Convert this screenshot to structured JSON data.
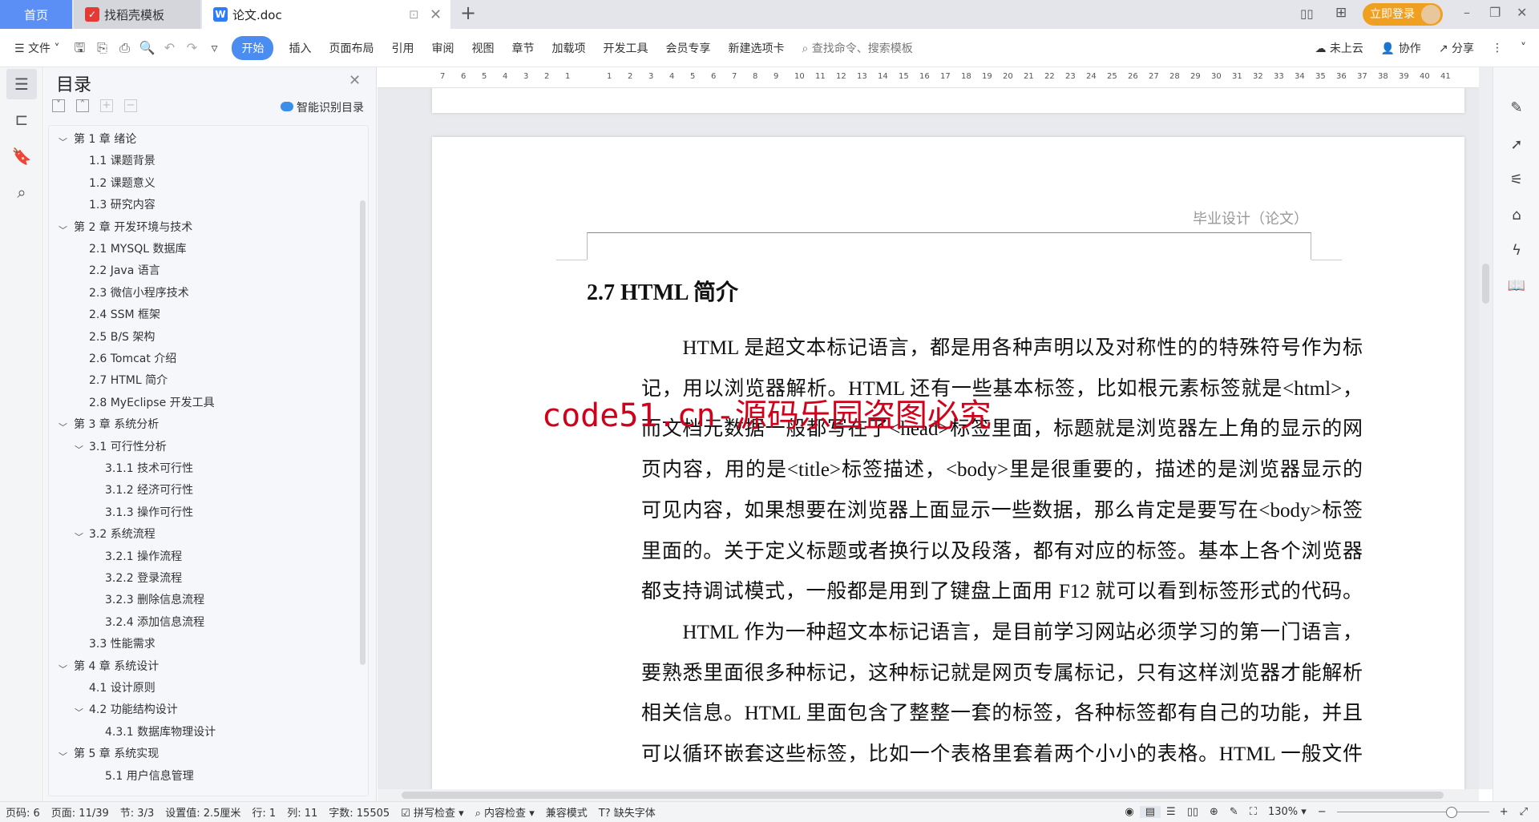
{
  "tabs": {
    "home": "首页",
    "template": "找稻壳模板",
    "doc": "论文.doc",
    "new_tab": "+"
  },
  "titlebar": {
    "login": "立即登录"
  },
  "toolbar": {
    "file": "文件",
    "menus": [
      "开始",
      "插入",
      "页面布局",
      "引用",
      "审阅",
      "视图",
      "章节",
      "加载项",
      "开发工具",
      "会员专享",
      "新建选项卡"
    ],
    "search_placeholder": "查找命令、搜索模板",
    "cloud": "未上云",
    "collab": "协作",
    "share": "分享"
  },
  "toc": {
    "title": "目录",
    "smart": "智能识别目录",
    "items": [
      {
        "label": "第 1 章  绪论",
        "level": 1,
        "expanded": true
      },
      {
        "label": "1.1  课题背景",
        "level": 2
      },
      {
        "label": "1.2  课题意义",
        "level": 2
      },
      {
        "label": "1.3  研究内容",
        "level": 2
      },
      {
        "label": "第 2 章  开发环境与技术",
        "level": 1,
        "expanded": true
      },
      {
        "label": "2.1 MYSQL 数据库",
        "level": 2
      },
      {
        "label": "2.2 Java 语言",
        "level": 2
      },
      {
        "label": "2.3  微信小程序技术",
        "level": 2
      },
      {
        "label": "2.4 SSM 框架",
        "level": 2
      },
      {
        "label": "2.5 B/S 架构",
        "level": 2
      },
      {
        "label": "2.6 Tomcat  介绍",
        "level": 2
      },
      {
        "label": "2.7 HTML 简介",
        "level": 2
      },
      {
        "label": "2.8 MyEclipse 开发工具",
        "level": 2
      },
      {
        "label": "第 3 章  系统分析",
        "level": 1,
        "expanded": true
      },
      {
        "label": "3.1  可行性分析",
        "level": 2,
        "expanded": true
      },
      {
        "label": "3.1.1  技术可行性",
        "level": 3
      },
      {
        "label": "3.1.2  经济可行性",
        "level": 3
      },
      {
        "label": "3.1.3  操作可行性",
        "level": 3
      },
      {
        "label": "3.2  系统流程",
        "level": 2,
        "expanded": true
      },
      {
        "label": "3.2.1  操作流程",
        "level": 3
      },
      {
        "label": "3.2.2  登录流程",
        "level": 3
      },
      {
        "label": "3.2.3  删除信息流程",
        "level": 3
      },
      {
        "label": "3.2.4  添加信息流程",
        "level": 3
      },
      {
        "label": "3.3  性能需求",
        "level": 2
      },
      {
        "label": "第 4 章  系统设计",
        "level": 1,
        "expanded": true
      },
      {
        "label": "4.1  设计原则",
        "level": 2
      },
      {
        "label": "4.2  功能结构设计",
        "level": 2,
        "expanded": true
      },
      {
        "label": "4.3.1  数据库物理设计",
        "level": 3
      },
      {
        "label": "第 5 章  系统实现",
        "level": 1,
        "expanded": true
      },
      {
        "label": "5.1 用户信息管理",
        "level": 3
      }
    ]
  },
  "ruler": {
    "ticks": [
      "7",
      "6",
      "5",
      "4",
      "3",
      "2",
      "1",
      "",
      "1",
      "2",
      "3",
      "4",
      "5",
      "6",
      "7",
      "8",
      "9",
      "10",
      "11",
      "12",
      "13",
      "14",
      "15",
      "16",
      "17",
      "18",
      "19",
      "20",
      "21",
      "22",
      "23",
      "24",
      "25",
      "26",
      "27",
      "28",
      "29",
      "30",
      "31",
      "32",
      "33",
      "34",
      "35",
      "36",
      "37",
      "38",
      "39",
      "40",
      "41"
    ]
  },
  "document": {
    "header": "毕业设计（论文）",
    "heading": "2.7 HTML 简介",
    "lines": [
      "　　HTML 是超文本标记语言，都是用各种声明以及对称性的的特殊符号作为标",
      "记，用以浏览器解析。HTML 还有一些基本标签，比如根元素标签就是<html>，",
      "而文档元数据一般都写在了<head>标签里面，标题就是浏览器左上角的显示的网",
      "页内容，用的是<title>标签描述，<body>里是很重要的，描述的是浏览器显示的",
      "可见内容，如果想要在浏览器上面显示一些数据，那么肯定是要写在<body>标签",
      "里面的。关于定义标题或者换行以及段落，都有对应的标签。基本上各个浏览器",
      "都支持调试模式，一般都是用到了键盘上面用 F12 就可以看到标签形式的代码。",
      "　　HTML 作为一种超文本标记语言，是目前学习网站必须学习的第一门语言，",
      "要熟悉里面很多种标记，这种标记就是网页专属标记，只有这样浏览器才能解析",
      "相关信息。HTML 里面包含了整整一套的标签，各种标签都有自己的功能，并且",
      "可以循环嵌套这些标签，比如一个表格里套着两个小小的表格。HTML 一般文件"
    ],
    "watermark": "code51.cn-源码乐园盗图必究",
    "watermark_color": "#d0021b"
  },
  "status": {
    "page_code": "页码: 6",
    "page": "页面: 11/39",
    "section": "节: 3/3",
    "setting": "设置值: 2.5厘米",
    "row": "行: 1",
    "col": "列: 11",
    "words": "字数: 15505",
    "spell": "拼写检查",
    "content": "内容检查",
    "compat": "兼容模式",
    "missing_font": "缺失字体",
    "zoom": "130%",
    "zoom_level": 130
  },
  "colors": {
    "accent": "#4a8cf0",
    "login": "#f0a020"
  }
}
